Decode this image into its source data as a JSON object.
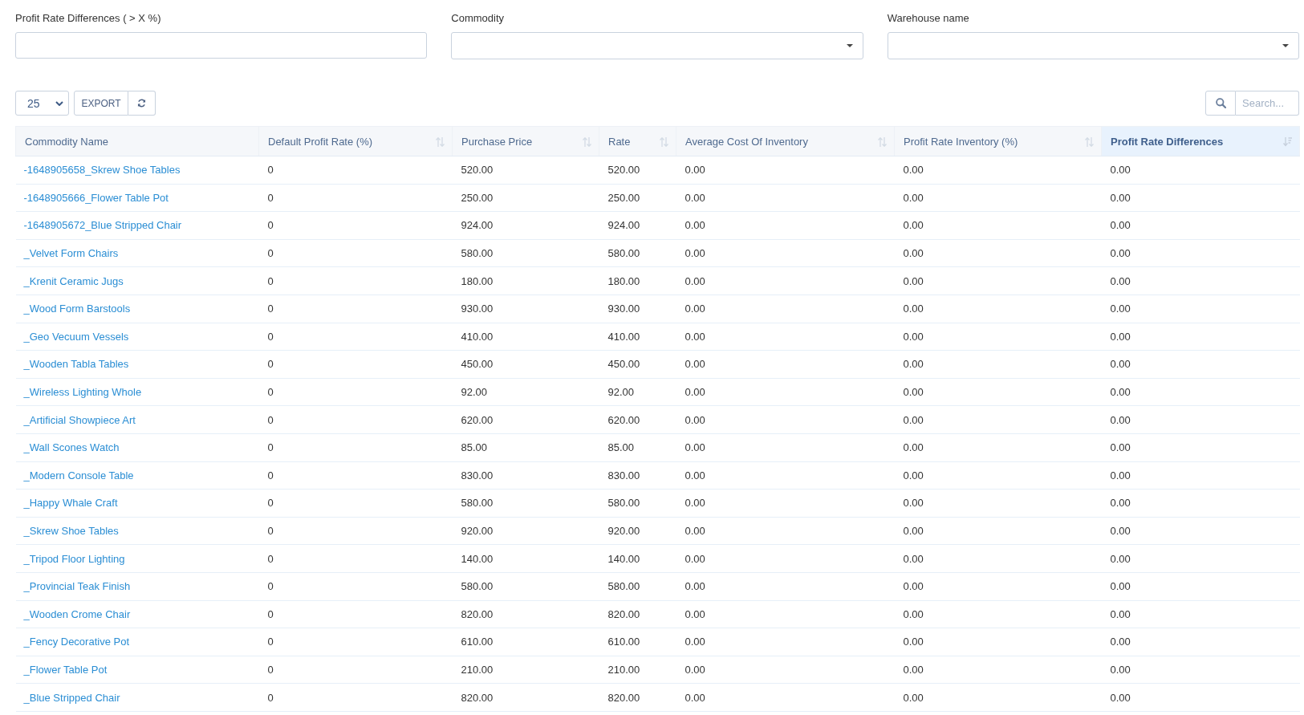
{
  "filters": [
    {
      "label": "Profit Rate Differences ( > X %)",
      "kind": "text"
    },
    {
      "label": "Commodity",
      "kind": "select"
    },
    {
      "label": "Warehouse name",
      "kind": "select"
    }
  ],
  "toolbar": {
    "page_size": "25",
    "export_button": "EXPORT",
    "search": {
      "placeholder": "Search..."
    }
  },
  "table": {
    "columns": [
      {
        "label": "Commodity Name",
        "kind": "link",
        "sortable": false,
        "sorted": false
      },
      {
        "label": "Default Profit Rate (%)",
        "kind": "text",
        "sortable": true,
        "sorted": false
      },
      {
        "label": "Purchase Price",
        "kind": "text",
        "sortable": true,
        "sorted": false
      },
      {
        "label": "Rate",
        "kind": "text",
        "sortable": true,
        "sorted": false
      },
      {
        "label": "Average Cost Of Inventory",
        "kind": "text",
        "sortable": true,
        "sorted": false
      },
      {
        "label": "Profit Rate Inventory (%)",
        "kind": "text",
        "sortable": true,
        "sorted": false
      },
      {
        "label": "Profit Rate Differences",
        "kind": "text",
        "sortable": true,
        "sorted": true
      }
    ],
    "rows": [
      [
        "-1648905658_Skrew Shoe Tables",
        "0",
        "520.00",
        "520.00",
        "0.00",
        "0.00",
        "0.00"
      ],
      [
        "-1648905666_Flower Table Pot",
        "0",
        "250.00",
        "250.00",
        "0.00",
        "0.00",
        "0.00"
      ],
      [
        "-1648905672_Blue Stripped Chair",
        "0",
        "924.00",
        "924.00",
        "0.00",
        "0.00",
        "0.00"
      ],
      [
        "_Velvet Form Chairs",
        "0",
        "580.00",
        "580.00",
        "0.00",
        "0.00",
        "0.00"
      ],
      [
        "_Krenit Ceramic Jugs",
        "0",
        "180.00",
        "180.00",
        "0.00",
        "0.00",
        "0.00"
      ],
      [
        "_Wood Form Barstools",
        "0",
        "930.00",
        "930.00",
        "0.00",
        "0.00",
        "0.00"
      ],
      [
        "_Geo Vecuum Vessels",
        "0",
        "410.00",
        "410.00",
        "0.00",
        "0.00",
        "0.00"
      ],
      [
        "_Wooden Tabla Tables",
        "0",
        "450.00",
        "450.00",
        "0.00",
        "0.00",
        "0.00"
      ],
      [
        "_Wireless Lighting Whole",
        "0",
        "92.00",
        "92.00",
        "0.00",
        "0.00",
        "0.00"
      ],
      [
        "_Artificial Showpiece Art",
        "0",
        "620.00",
        "620.00",
        "0.00",
        "0.00",
        "0.00"
      ],
      [
        "_Wall Scones Watch",
        "0",
        "85.00",
        "85.00",
        "0.00",
        "0.00",
        "0.00"
      ],
      [
        "_Modern Console Table",
        "0",
        "830.00",
        "830.00",
        "0.00",
        "0.00",
        "0.00"
      ],
      [
        "_Happy Whale Craft",
        "0",
        "580.00",
        "580.00",
        "0.00",
        "0.00",
        "0.00"
      ],
      [
        "_Skrew Shoe Tables",
        "0",
        "920.00",
        "920.00",
        "0.00",
        "0.00",
        "0.00"
      ],
      [
        "_Tripod Floor Lighting",
        "0",
        "140.00",
        "140.00",
        "0.00",
        "0.00",
        "0.00"
      ],
      [
        "_Provincial Teak Finish",
        "0",
        "580.00",
        "580.00",
        "0.00",
        "0.00",
        "0.00"
      ],
      [
        "_Wooden Crome Chair",
        "0",
        "820.00",
        "820.00",
        "0.00",
        "0.00",
        "0.00"
      ],
      [
        "_Fency Decorative Pot",
        "0",
        "610.00",
        "610.00",
        "0.00",
        "0.00",
        "0.00"
      ],
      [
        "_Flower Table Pot",
        "0",
        "210.00",
        "210.00",
        "0.00",
        "0.00",
        "0.00"
      ],
      [
        "_Blue Stripped Chair",
        "0",
        "820.00",
        "820.00",
        "0.00",
        "0.00",
        "0.00"
      ]
    ]
  }
}
